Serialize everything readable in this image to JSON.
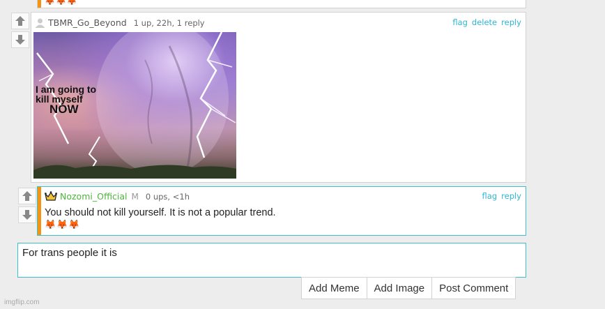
{
  "prev_comment": {
    "emojis": "🦊🦊🦊"
  },
  "comment1": {
    "username": "TBMR_Go_Beyond",
    "stats": "1 up, 22h, 1 reply",
    "actions": [
      "flag",
      "delete",
      "reply"
    ],
    "meme_caption_line1": "I am going to",
    "meme_caption_line2": "kill myself",
    "meme_caption_line3": "NOW"
  },
  "comment2": {
    "username": "Nozomi_Official",
    "mod_badge": "M",
    "stats": "0 ups, <1h",
    "actions": [
      "flag",
      "reply"
    ],
    "text": "You should not kill yourself. It is not a popular trend.",
    "emojis": "🦊🦊🦊"
  },
  "reply_box": {
    "value": "For trans people it is"
  },
  "buttons": {
    "add_meme": "Add Meme",
    "add_image": "Add Image",
    "post_comment": "Post Comment"
  },
  "watermark": "imgflip.com",
  "colors": {
    "accent": "#3cc1cc",
    "orange": "#f29516",
    "link": "#2fb5d1",
    "green": "#4db53c"
  }
}
